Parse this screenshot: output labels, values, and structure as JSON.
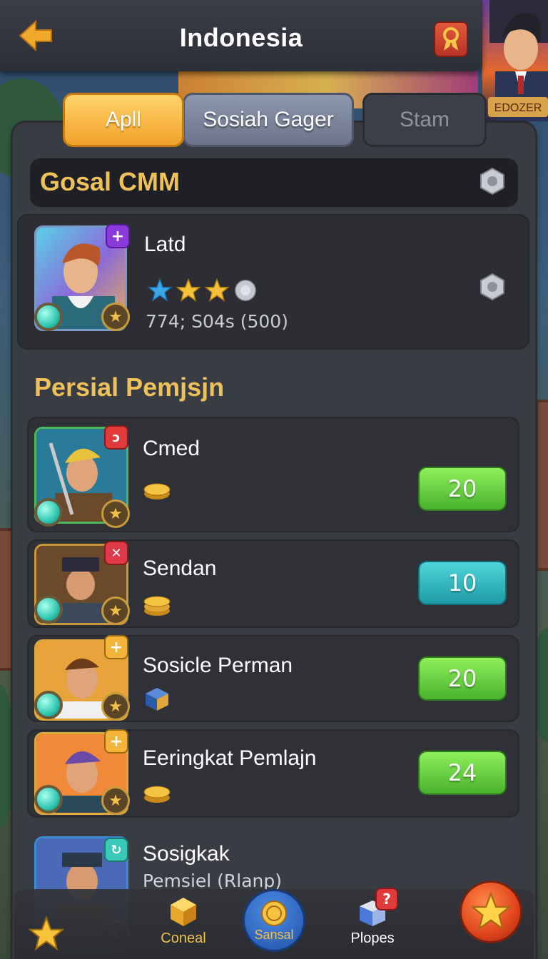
{
  "header": {
    "title": "Indonesia",
    "back_icon": "back-arrow-icon",
    "ribbon_icon": "award-ribbon-icon"
  },
  "tabs": [
    {
      "label": "Apll",
      "active": true
    },
    {
      "label": "Sosiah Gager",
      "active": false
    },
    {
      "label": "Stam",
      "active": false
    }
  ],
  "global": {
    "title": "Gosal CMM",
    "featured": {
      "name": "Latd",
      "stats": "774; S04s (500)",
      "stars": [
        "blue-star",
        "gold-star",
        "gold-star",
        "silver-coin"
      ]
    }
  },
  "section": {
    "title": "Persial Pemjsjn",
    "rows": [
      {
        "name": "Cmed",
        "value": "20",
        "reward_icon": "coin-stack-icon",
        "button_color": "green"
      },
      {
        "name": "Sendan",
        "value": "10",
        "reward_icon": "coin-stack-icon",
        "button_color": "teal"
      },
      {
        "name": "Sosicle Perman",
        "value": "20",
        "reward_icon": "crate-icon",
        "button_color": "green"
      },
      {
        "name": "Eeringkat Pemlajn",
        "value": "24",
        "reward_icon": "coin-stack-icon",
        "button_color": "green"
      },
      {
        "name": "Sosigkak",
        "subtitle": "Pemsiel (Rlanp)"
      }
    ]
  },
  "nav": {
    "left_label": "Coneal",
    "center_label": "Sansal",
    "right_label": "Plopes",
    "right_badge": "?"
  },
  "colors": {
    "accent_gold": "#efc15a",
    "button_green": "#49b22e",
    "button_teal": "#1e9aa6",
    "panel": "#3a3c43"
  }
}
